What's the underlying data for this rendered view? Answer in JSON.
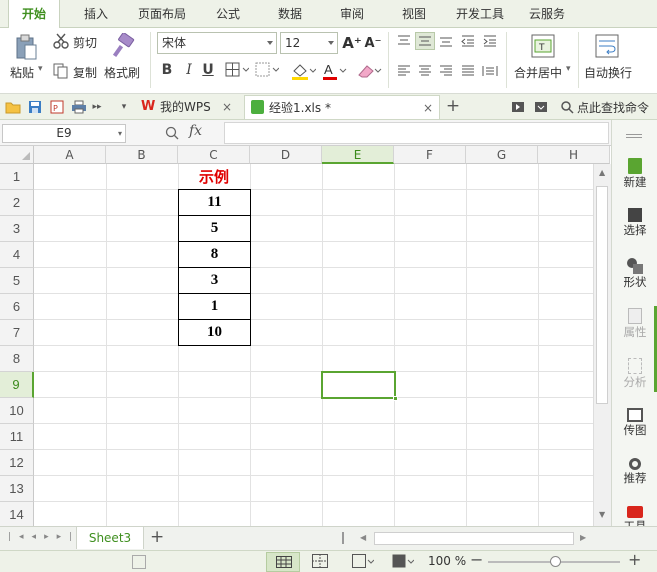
{
  "menu": {
    "tabs": [
      "开始",
      "插入",
      "页面布局",
      "公式",
      "数据",
      "审阅",
      "视图",
      "开发工具",
      "云服务"
    ],
    "active_index": 0
  },
  "ribbon": {
    "paste_label": "粘贴",
    "cut_label": "剪切",
    "copy_label": "复制",
    "format_painter_label": "格式刷",
    "font_name": "宋体",
    "font_size": "12",
    "font_grow_icon": "A⁺",
    "font_shrink_icon": "A⁻",
    "bold": "B",
    "italic": "I",
    "underline": "U",
    "merge_label": "合并居中",
    "wrap_label": "自动换行"
  },
  "quickbar": {
    "tabs": [
      {
        "label": "我的WPS",
        "close": "×"
      },
      {
        "label": "经验1.xls *",
        "close": "×"
      }
    ],
    "add_tab": "+",
    "search_label": "点此查找命令"
  },
  "formula": {
    "cell_ref": "E9",
    "fx_label": "fx",
    "value": ""
  },
  "grid": {
    "columns": [
      "A",
      "B",
      "C",
      "D",
      "E",
      "F",
      "G",
      "H"
    ],
    "rows": [
      "1",
      "2",
      "3",
      "4",
      "5",
      "6",
      "7",
      "8",
      "9",
      "10",
      "11",
      "12",
      "13",
      "14"
    ],
    "selected_col": "E",
    "selected_row": "9",
    "title_cell": "示例",
    "title_color": "#e00000",
    "values": [
      "11",
      "5",
      "8",
      "3",
      "1",
      "10"
    ]
  },
  "sidepanel": {
    "items": [
      {
        "label": "新建",
        "icon": "new-icon",
        "enabled": true
      },
      {
        "label": "选择",
        "icon": "select-icon",
        "enabled": true
      },
      {
        "label": "形状",
        "icon": "shape-icon",
        "enabled": true
      },
      {
        "label": "属性",
        "icon": "property-icon",
        "enabled": false
      },
      {
        "label": "分析",
        "icon": "analysis-icon",
        "enabled": false
      },
      {
        "label": "传图",
        "icon": "image-upload-icon",
        "enabled": true
      },
      {
        "label": "推荐",
        "icon": "recommend-icon",
        "enabled": true
      },
      {
        "label": "工具",
        "icon": "toolbox-icon",
        "enabled": true
      }
    ]
  },
  "sheets": {
    "tabs": [
      "Sheet3"
    ],
    "add": "+"
  },
  "status": {
    "zoom": "100 %",
    "zoom_level": 1.0,
    "minus": "−",
    "plus": "+"
  },
  "colors": {
    "accent": "#5aa531",
    "menu_bg": "#eef2e8"
  }
}
